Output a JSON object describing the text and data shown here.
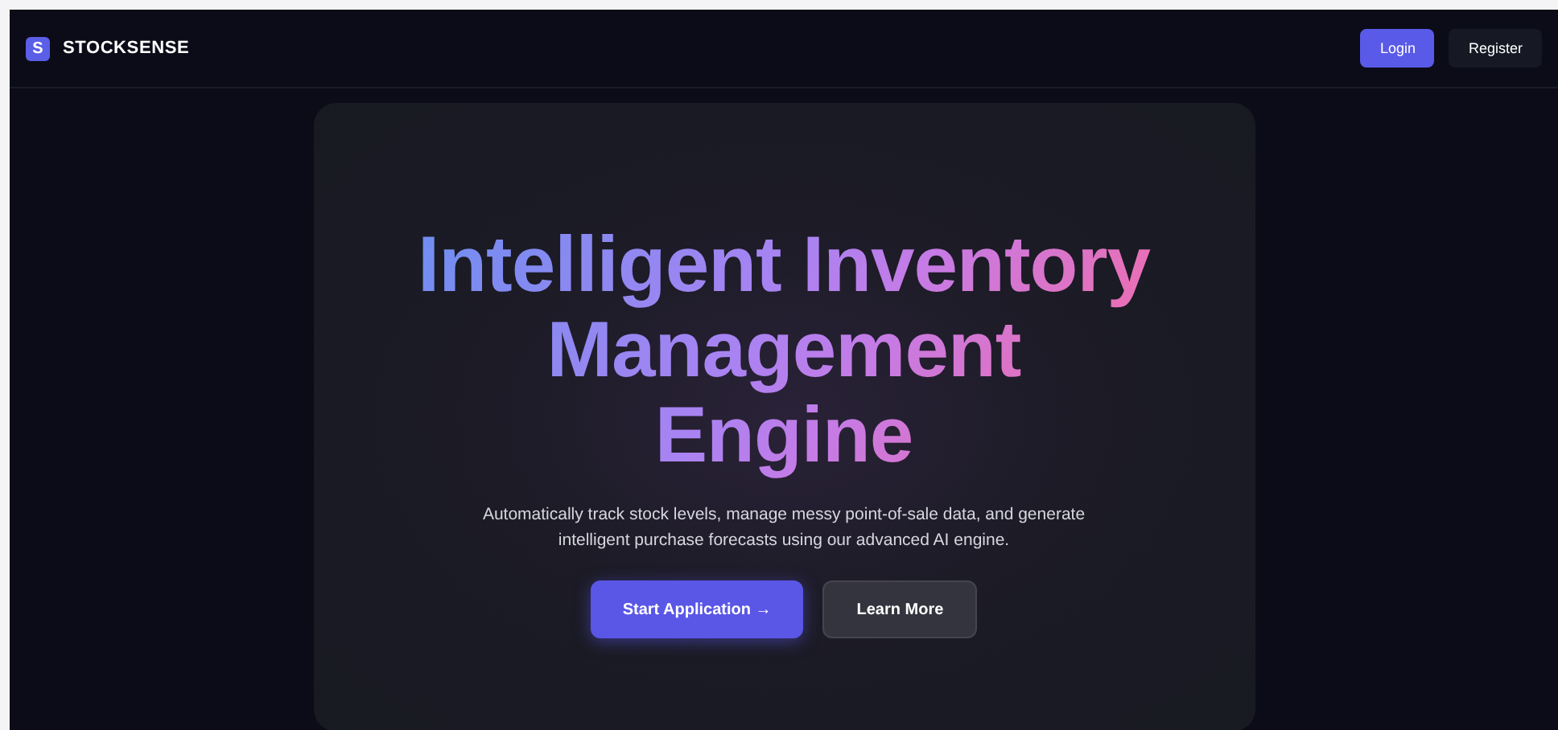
{
  "navbar": {
    "logo_letter": "S",
    "brand": "STOCKSENSE",
    "buttons": [
      {
        "label": "Login",
        "kind": "primary"
      },
      {
        "label": "Register",
        "kind": "secondary"
      }
    ]
  },
  "hero": {
    "title_lines": [
      "Intelligent Inventory",
      "Management",
      "Engine"
    ],
    "description": "Automatically track stock levels, manage messy point-of-sale data, and generate intelligent purchase forecasts using our advanced AI engine.",
    "buttons": [
      {
        "label": "Start Application →",
        "kind": "primary"
      },
      {
        "label": "Learn More",
        "kind": "secondary"
      }
    ]
  }
}
